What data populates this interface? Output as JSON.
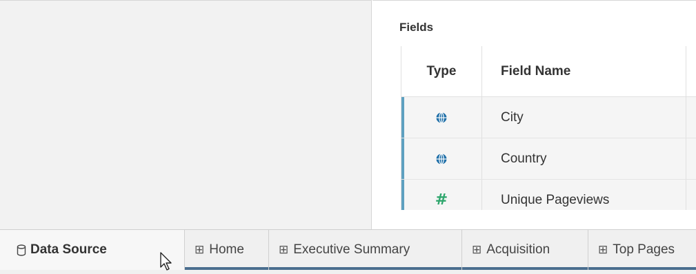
{
  "fields": {
    "title": "Fields",
    "columns": [
      "Type",
      "Field Name"
    ],
    "rows": [
      {
        "type_icon": "globe-icon",
        "name": "City"
      },
      {
        "type_icon": "globe-icon",
        "name": "Country"
      },
      {
        "type_icon": "hash-icon",
        "type_glyph": "#",
        "name": "Unique Pageviews"
      }
    ]
  },
  "tabs": [
    {
      "label": "Data Source",
      "icon": "database-icon",
      "active": true
    },
    {
      "label": "Home",
      "icon": "sheet-icon",
      "glyph": "⊞"
    },
    {
      "label": "Executive Summary",
      "icon": "sheet-icon",
      "glyph": "⊞"
    },
    {
      "label": "Acquisition",
      "icon": "sheet-icon",
      "glyph": "⊞"
    },
    {
      "label": "Top Pages",
      "icon": "sheet-icon",
      "glyph": "⊞"
    }
  ],
  "colors": {
    "accent": "#5ea0c0",
    "tab_underline": "#4a6e8f",
    "measure": "#2fa66d",
    "dimension": "#1f77b4"
  }
}
